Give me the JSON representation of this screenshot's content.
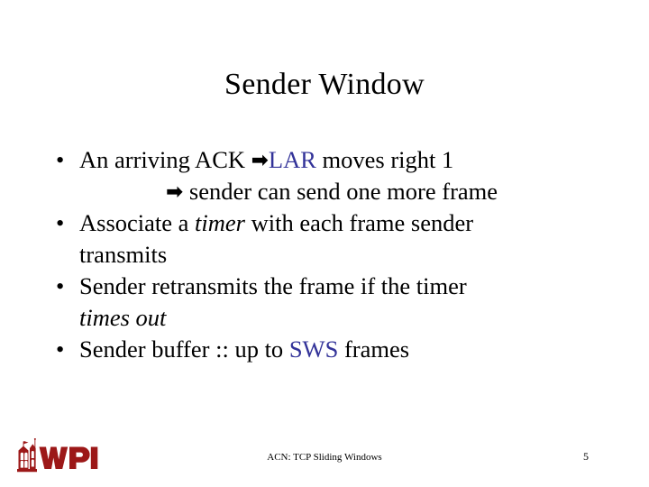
{
  "slide": {
    "title": "Sender Window",
    "bullet_marker": "•",
    "arrow_glyph": "➡",
    "accent_color": "#333399",
    "logo_color": "#9C1818",
    "bullets": [
      {
        "id": "ack-lar",
        "line1_before": "An arriving ACK ",
        "line1_keyword": "LAR",
        "line1_after": " moves right 1",
        "line2": " sender can send one more frame"
      },
      {
        "id": "associate-timer",
        "part1": "Associate a ",
        "italic": "timer",
        "part2": " with each frame sender",
        "wrap": "transmits"
      },
      {
        "id": "retransmit-timeout",
        "part1": "Sender retransmits the frame if the timer",
        "italic_wrap": "times out"
      },
      {
        "id": "sender-buffer",
        "part1": "Sender buffer :: up to ",
        "keyword": "SWS",
        "part2": " frames"
      }
    ]
  },
  "footer": {
    "text": "ACN: TCP Sliding Windows",
    "page_number": "5",
    "logo_label": "WPI"
  }
}
